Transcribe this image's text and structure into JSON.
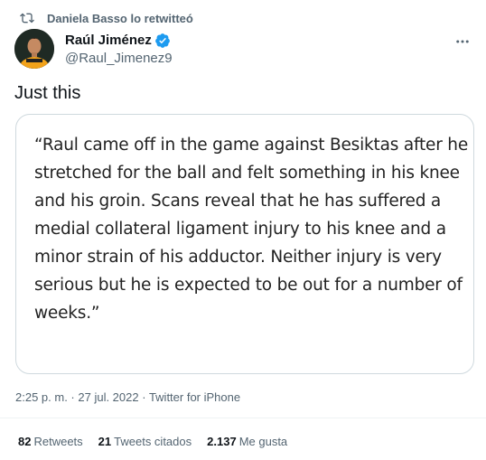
{
  "retweet": {
    "label": "Daniela Basso lo retwitteó"
  },
  "author": {
    "name": "Raúl Jiménez",
    "handle": "@Raul_Jimenez9"
  },
  "tweet": {
    "text": "Just this",
    "quote_lines": [
      "“Raul came off in the game against Besiktas after he",
      "stretched for the ball and felt something in his knee",
      "and his groin. Scans reveal that he has suffered a",
      "medial collateral ligament injury to his knee and a",
      "minor strain of his adductor. Neither injury is very",
      "serious but he is expected to be out for a number of",
      "weeks.”"
    ]
  },
  "meta": {
    "time": "2:25 p. m.",
    "sep1": " · ",
    "date": "27 jul. 2022",
    "sep2": " · ",
    "source": "Twitter for iPhone"
  },
  "stats": {
    "retweets_count": "82",
    "retweets_label": "Retweets",
    "quotes_count": "21",
    "quotes_label": "Tweets citados",
    "likes_count": "2.137",
    "likes_label": "Me gusta"
  },
  "icons": {
    "retweet": "retweet-icon",
    "verified": "verified-badge-icon",
    "more": "more-options-icon"
  },
  "colors": {
    "verified": "#1d9bf0",
    "secondary_text": "#536471",
    "primary_text": "#0f1419",
    "border": "#cfd9de"
  }
}
